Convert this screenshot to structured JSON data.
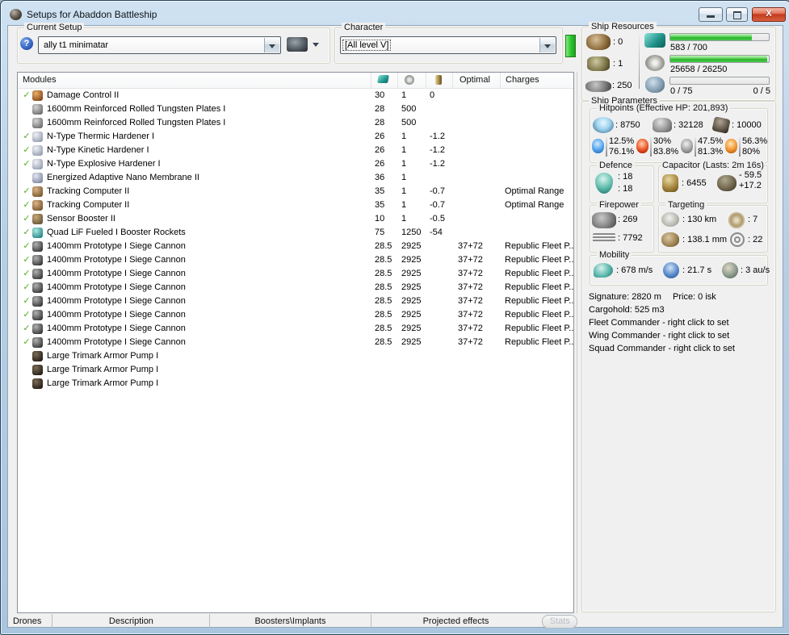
{
  "window": {
    "title": "Setups for Abaddon Battleship"
  },
  "toolbar": {
    "current_setup": {
      "label": "Current Setup",
      "value": "ally t1 minimatar"
    },
    "character": {
      "label": "Character",
      "value": "[All level V]"
    }
  },
  "modules_table": {
    "title": "Modules",
    "optimal_header": "Optimal",
    "charges_header": "Charges",
    "check_glyph": "✓",
    "rows": [
      {
        "fitted": true,
        "icon": "damage-control",
        "name": "Damage Control II",
        "cpu": "30",
        "qty": "1",
        "cap": "0",
        "optimal": "",
        "charges": ""
      },
      {
        "fitted": false,
        "icon": "plate",
        "name": "1600mm Reinforced Rolled Tungsten Plates I",
        "cpu": "28",
        "qty": "500",
        "cap": "",
        "optimal": "",
        "charges": ""
      },
      {
        "fitted": false,
        "icon": "plate",
        "name": "1600mm Reinforced Rolled Tungsten Plates I",
        "cpu": "28",
        "qty": "500",
        "cap": "",
        "optimal": "",
        "charges": ""
      },
      {
        "fitted": true,
        "icon": "hardener",
        "name": "N-Type Thermic Hardener I",
        "cpu": "26",
        "qty": "1",
        "cap": "-1.2",
        "optimal": "",
        "charges": ""
      },
      {
        "fitted": true,
        "icon": "hardener",
        "name": "N-Type Kinetic Hardener I",
        "cpu": "26",
        "qty": "1",
        "cap": "-1.2",
        "optimal": "",
        "charges": ""
      },
      {
        "fitted": true,
        "icon": "hardener",
        "name": "N-Type Explosive Hardener I",
        "cpu": "26",
        "qty": "1",
        "cap": "-1.2",
        "optimal": "",
        "charges": ""
      },
      {
        "fitted": false,
        "icon": "membrane",
        "name": "Energized Adaptive Nano Membrane II",
        "cpu": "36",
        "qty": "1",
        "cap": "",
        "optimal": "",
        "charges": ""
      },
      {
        "fitted": true,
        "icon": "tracking",
        "name": "Tracking Computer II",
        "cpu": "35",
        "qty": "1",
        "cap": "-0.7",
        "optimal": "",
        "charges": "Optimal Range"
      },
      {
        "fitted": true,
        "icon": "tracking",
        "name": "Tracking Computer II",
        "cpu": "35",
        "qty": "1",
        "cap": "-0.7",
        "optimal": "",
        "charges": "Optimal Range"
      },
      {
        "fitted": true,
        "icon": "sensor",
        "name": "Sensor Booster II",
        "cpu": "10",
        "qty": "1",
        "cap": "-0.5",
        "optimal": "",
        "charges": ""
      },
      {
        "fitted": true,
        "icon": "rocket",
        "name": "Quad LiF Fueled I Booster Rockets",
        "cpu": "75",
        "qty": "1250",
        "cap": "-54",
        "optimal": "",
        "charges": ""
      },
      {
        "fitted": true,
        "icon": "cannon",
        "name": "1400mm Prototype I Siege Cannon",
        "cpu": "28.5",
        "qty": "2925",
        "cap": "",
        "optimal": "37+72",
        "charges": "Republic Fleet P..."
      },
      {
        "fitted": true,
        "icon": "cannon",
        "name": "1400mm Prototype I Siege Cannon",
        "cpu": "28.5",
        "qty": "2925",
        "cap": "",
        "optimal": "37+72",
        "charges": "Republic Fleet P..."
      },
      {
        "fitted": true,
        "icon": "cannon",
        "name": "1400mm Prototype I Siege Cannon",
        "cpu": "28.5",
        "qty": "2925",
        "cap": "",
        "optimal": "37+72",
        "charges": "Republic Fleet P..."
      },
      {
        "fitted": true,
        "icon": "cannon",
        "name": "1400mm Prototype I Siege Cannon",
        "cpu": "28.5",
        "qty": "2925",
        "cap": "",
        "optimal": "37+72",
        "charges": "Republic Fleet P..."
      },
      {
        "fitted": true,
        "icon": "cannon",
        "name": "1400mm Prototype I Siege Cannon",
        "cpu": "28.5",
        "qty": "2925",
        "cap": "",
        "optimal": "37+72",
        "charges": "Republic Fleet P..."
      },
      {
        "fitted": true,
        "icon": "cannon",
        "name": "1400mm Prototype I Siege Cannon",
        "cpu": "28.5",
        "qty": "2925",
        "cap": "",
        "optimal": "37+72",
        "charges": "Republic Fleet P..."
      },
      {
        "fitted": true,
        "icon": "cannon",
        "name": "1400mm Prototype I Siege Cannon",
        "cpu": "28.5",
        "qty": "2925",
        "cap": "",
        "optimal": "37+72",
        "charges": "Republic Fleet P..."
      },
      {
        "fitted": true,
        "icon": "cannon",
        "name": "1400mm Prototype I Siege Cannon",
        "cpu": "28.5",
        "qty": "2925",
        "cap": "",
        "optimal": "37+72",
        "charges": "Republic Fleet P..."
      },
      {
        "fitted": false,
        "icon": "pump",
        "name": "Large Trimark Armor Pump I",
        "cpu": "",
        "qty": "",
        "cap": "",
        "optimal": "",
        "charges": ""
      },
      {
        "fitted": false,
        "icon": "pump",
        "name": "Large Trimark Armor Pump I",
        "cpu": "",
        "qty": "",
        "cap": "",
        "optimal": "",
        "charges": ""
      },
      {
        "fitted": false,
        "icon": "pump",
        "name": "Large Trimark Armor Pump I",
        "cpu": "",
        "qty": "",
        "cap": "",
        "optimal": "",
        "charges": ""
      }
    ]
  },
  "ship_resources": {
    "title": "Ship Resources",
    "turrets": ": 0",
    "launchers": ": 1",
    "calibration": ": 250",
    "cpu": {
      "text": "583 / 700",
      "percent": 83
    },
    "powergrid": {
      "text": "25658 / 26250",
      "percent": 98
    },
    "drones": {
      "left": "0 / 75",
      "right": "0 / 5",
      "percent": 0
    }
  },
  "ship_parameters": {
    "title": "Ship Parameters",
    "hitpoints": {
      "title": "Hitpoints (Effective HP: 201,893)",
      "shield": ": 8750",
      "armor": ": 32128",
      "hull": ": 10000",
      "resists": [
        {
          "top": "12.5%",
          "bottom": "76.1%"
        },
        {
          "top": "30%",
          "bottom": "83.8%"
        },
        {
          "top": "47.5%",
          "bottom": "81.3%"
        },
        {
          "top": "56.3%",
          "bottom": "80%"
        }
      ]
    },
    "defence": {
      "title": "Defence",
      "v1": ": 18",
      "v2": ": 18"
    },
    "capacitor": {
      "title": "Capacitor (Lasts: 2m 16s)",
      "amount": ": 6455",
      "drain": "- 59.5",
      "recharge": "+17.2"
    },
    "firepower": {
      "title": "Firepower",
      "volley": ": 269",
      "dps": ": 7792"
    },
    "targeting": {
      "title": "Targeting",
      "range": ": 130 km",
      "max_targets": ": 7",
      "scan_res": ": 138.1 mm",
      "sensor_strength": ": 22"
    },
    "mobility": {
      "title": "Mobility",
      "speed": ": 678 m/s",
      "align": ": 21.7 s",
      "warp": ": 3 au/s"
    }
  },
  "info": {
    "signature": "Signature: 2820 m",
    "price": "Price: 0 isk",
    "cargohold": "Cargohold: 525 m3",
    "fleet": "Fleet Commander - right click to set",
    "wing": "Wing Commander - right click to set",
    "squad": "Squad Commander - right click to set"
  },
  "bottom": {
    "tabs": [
      "Drones",
      "Description",
      "Boosters\\Implants",
      "Projected effects"
    ],
    "stats_button": "Stats"
  }
}
